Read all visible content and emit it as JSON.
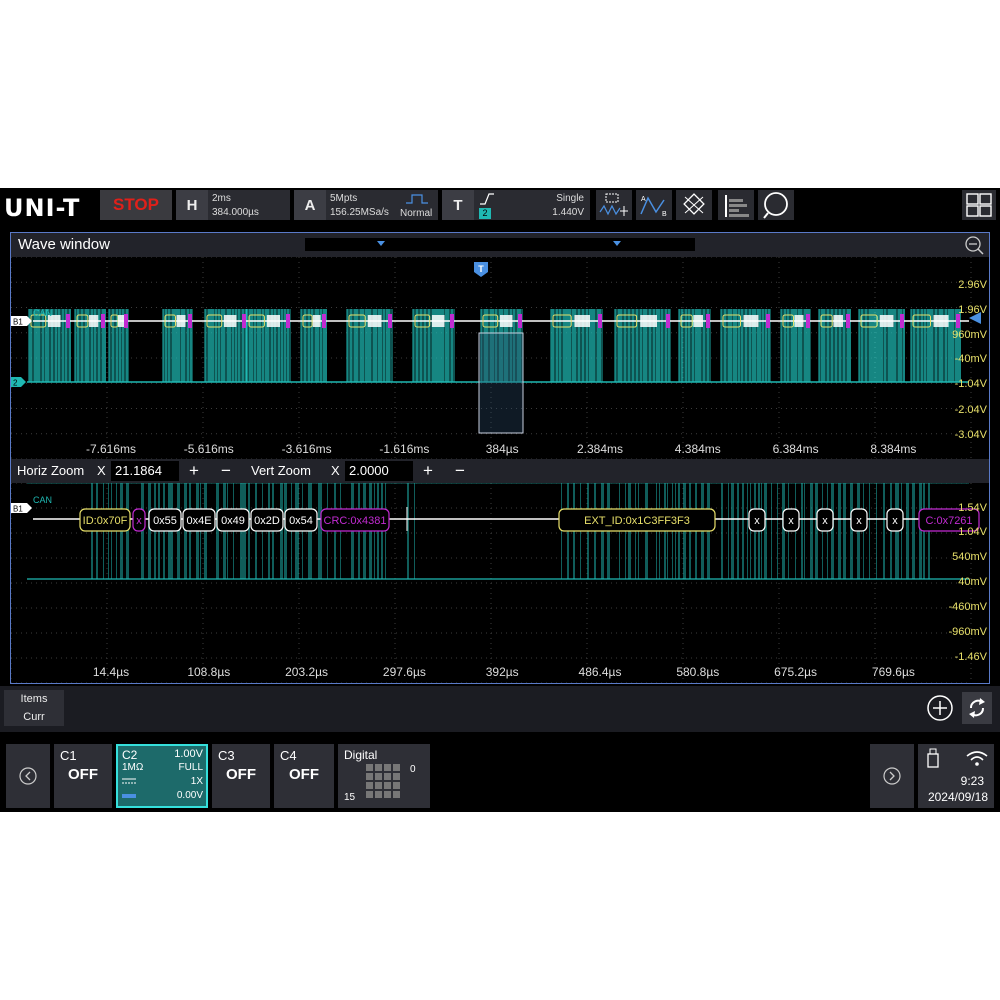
{
  "topbar": {
    "logo": "UNI-T",
    "run_state": "STOP",
    "horizontal": {
      "letter": "H",
      "scale": "2ms",
      "position": "384.000µs"
    },
    "acquire": {
      "letter": "A",
      "depth": "5Mpts",
      "rate": "156.25MSa/s",
      "mode": "Normal"
    },
    "trigger": {
      "letter": "T",
      "mode": "Single",
      "level": "1.440V",
      "source": "2"
    },
    "icons": [
      "cursor-measure-icon",
      "measure-icon",
      "math-icon",
      "ref-icon",
      "search-icon",
      "layout-icon"
    ]
  },
  "wave_window": {
    "title": "Wave window",
    "trigger_marker": "T",
    "bus_label": "B1",
    "bus_protocol": "CAN",
    "ch2_label": "2",
    "right_labels": [
      "2.96V",
      "1.96V",
      "960mV",
      "-40mV",
      "-1.04V",
      "-2.04V",
      "-3.04V"
    ],
    "time_labels": [
      "-7.616ms",
      "-5.616ms",
      "-3.616ms",
      "-1.616ms",
      "384µs",
      "2.384ms",
      "4.384ms",
      "6.384ms",
      "8.384ms"
    ]
  },
  "zoom_bar": {
    "horiz_label": "Horiz Zoom",
    "horiz_x": "X",
    "horiz_value": "21.1864",
    "vert_label": "Vert Zoom",
    "vert_x": "X",
    "vert_value": "2.0000",
    "plus": "+",
    "minus": "−"
  },
  "zoom_window": {
    "bus_label": "B1",
    "bus_protocol": "CAN",
    "packets": [
      "ID:0x70F",
      "x",
      "0x55",
      "0x4E",
      "0x49",
      "0x2D",
      "0x54",
      "CRC:0x4381",
      "EXT_ID:0x1C3FF3F3",
      "x",
      "x",
      "x",
      "x",
      "x",
      "C:0x7261"
    ],
    "right_labels": [
      "1.54V",
      "1.04V",
      "540mV",
      "40mV",
      "-460mV",
      "-960mV",
      "-1.46V"
    ],
    "time_labels": [
      "14.4µs",
      "108.8µs",
      "203.2µs",
      "297.6µs",
      "392µs",
      "486.4µs",
      "580.8µs",
      "675.2µs",
      "769.6µs"
    ]
  },
  "items_bar": {
    "tabs": [
      "Items",
      "Curr"
    ]
  },
  "channels": {
    "c1": {
      "name": "C1",
      "state": "OFF"
    },
    "c2": {
      "name": "C2",
      "scale": "1.00V",
      "impedance": "1MΩ",
      "bandwidth": "FULL",
      "probe": "1X",
      "offset": "0.00V"
    },
    "c3": {
      "name": "C3",
      "state": "OFF"
    },
    "c4": {
      "name": "C4",
      "state": "OFF"
    },
    "digital": {
      "name": "Digital",
      "high": "0",
      "low": "15"
    }
  },
  "status": {
    "time": "9:23",
    "date": "2024/09/18"
  },
  "colors": {
    "ch2": "#1fb9b3",
    "packet_id": "#e8e06a",
    "packet_crc": "#c22bd2",
    "grid": "#3c3c3c",
    "accent_blue": "#4a90e2"
  }
}
